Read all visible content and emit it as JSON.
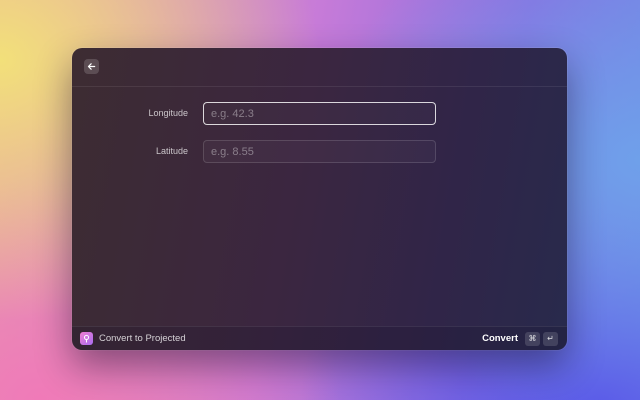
{
  "header": {
    "back_icon": "arrow-left-icon"
  },
  "form": {
    "fields": [
      {
        "label": "Longitude",
        "value": "",
        "placeholder": "e.g. 42.3",
        "focused": true
      },
      {
        "label": "Latitude",
        "value": "",
        "placeholder": "e.g. 8.55",
        "focused": false
      }
    ]
  },
  "footer": {
    "extension_icon": "map-pin-icon",
    "title": "Convert to Projected",
    "primary_action": "Convert",
    "shortcut_keys": [
      "⌘",
      "↵"
    ]
  },
  "colors": {
    "extension_icon_start": "#f07fd0",
    "extension_icon_end": "#a96cf0",
    "focus_border": "#ffffff"
  }
}
